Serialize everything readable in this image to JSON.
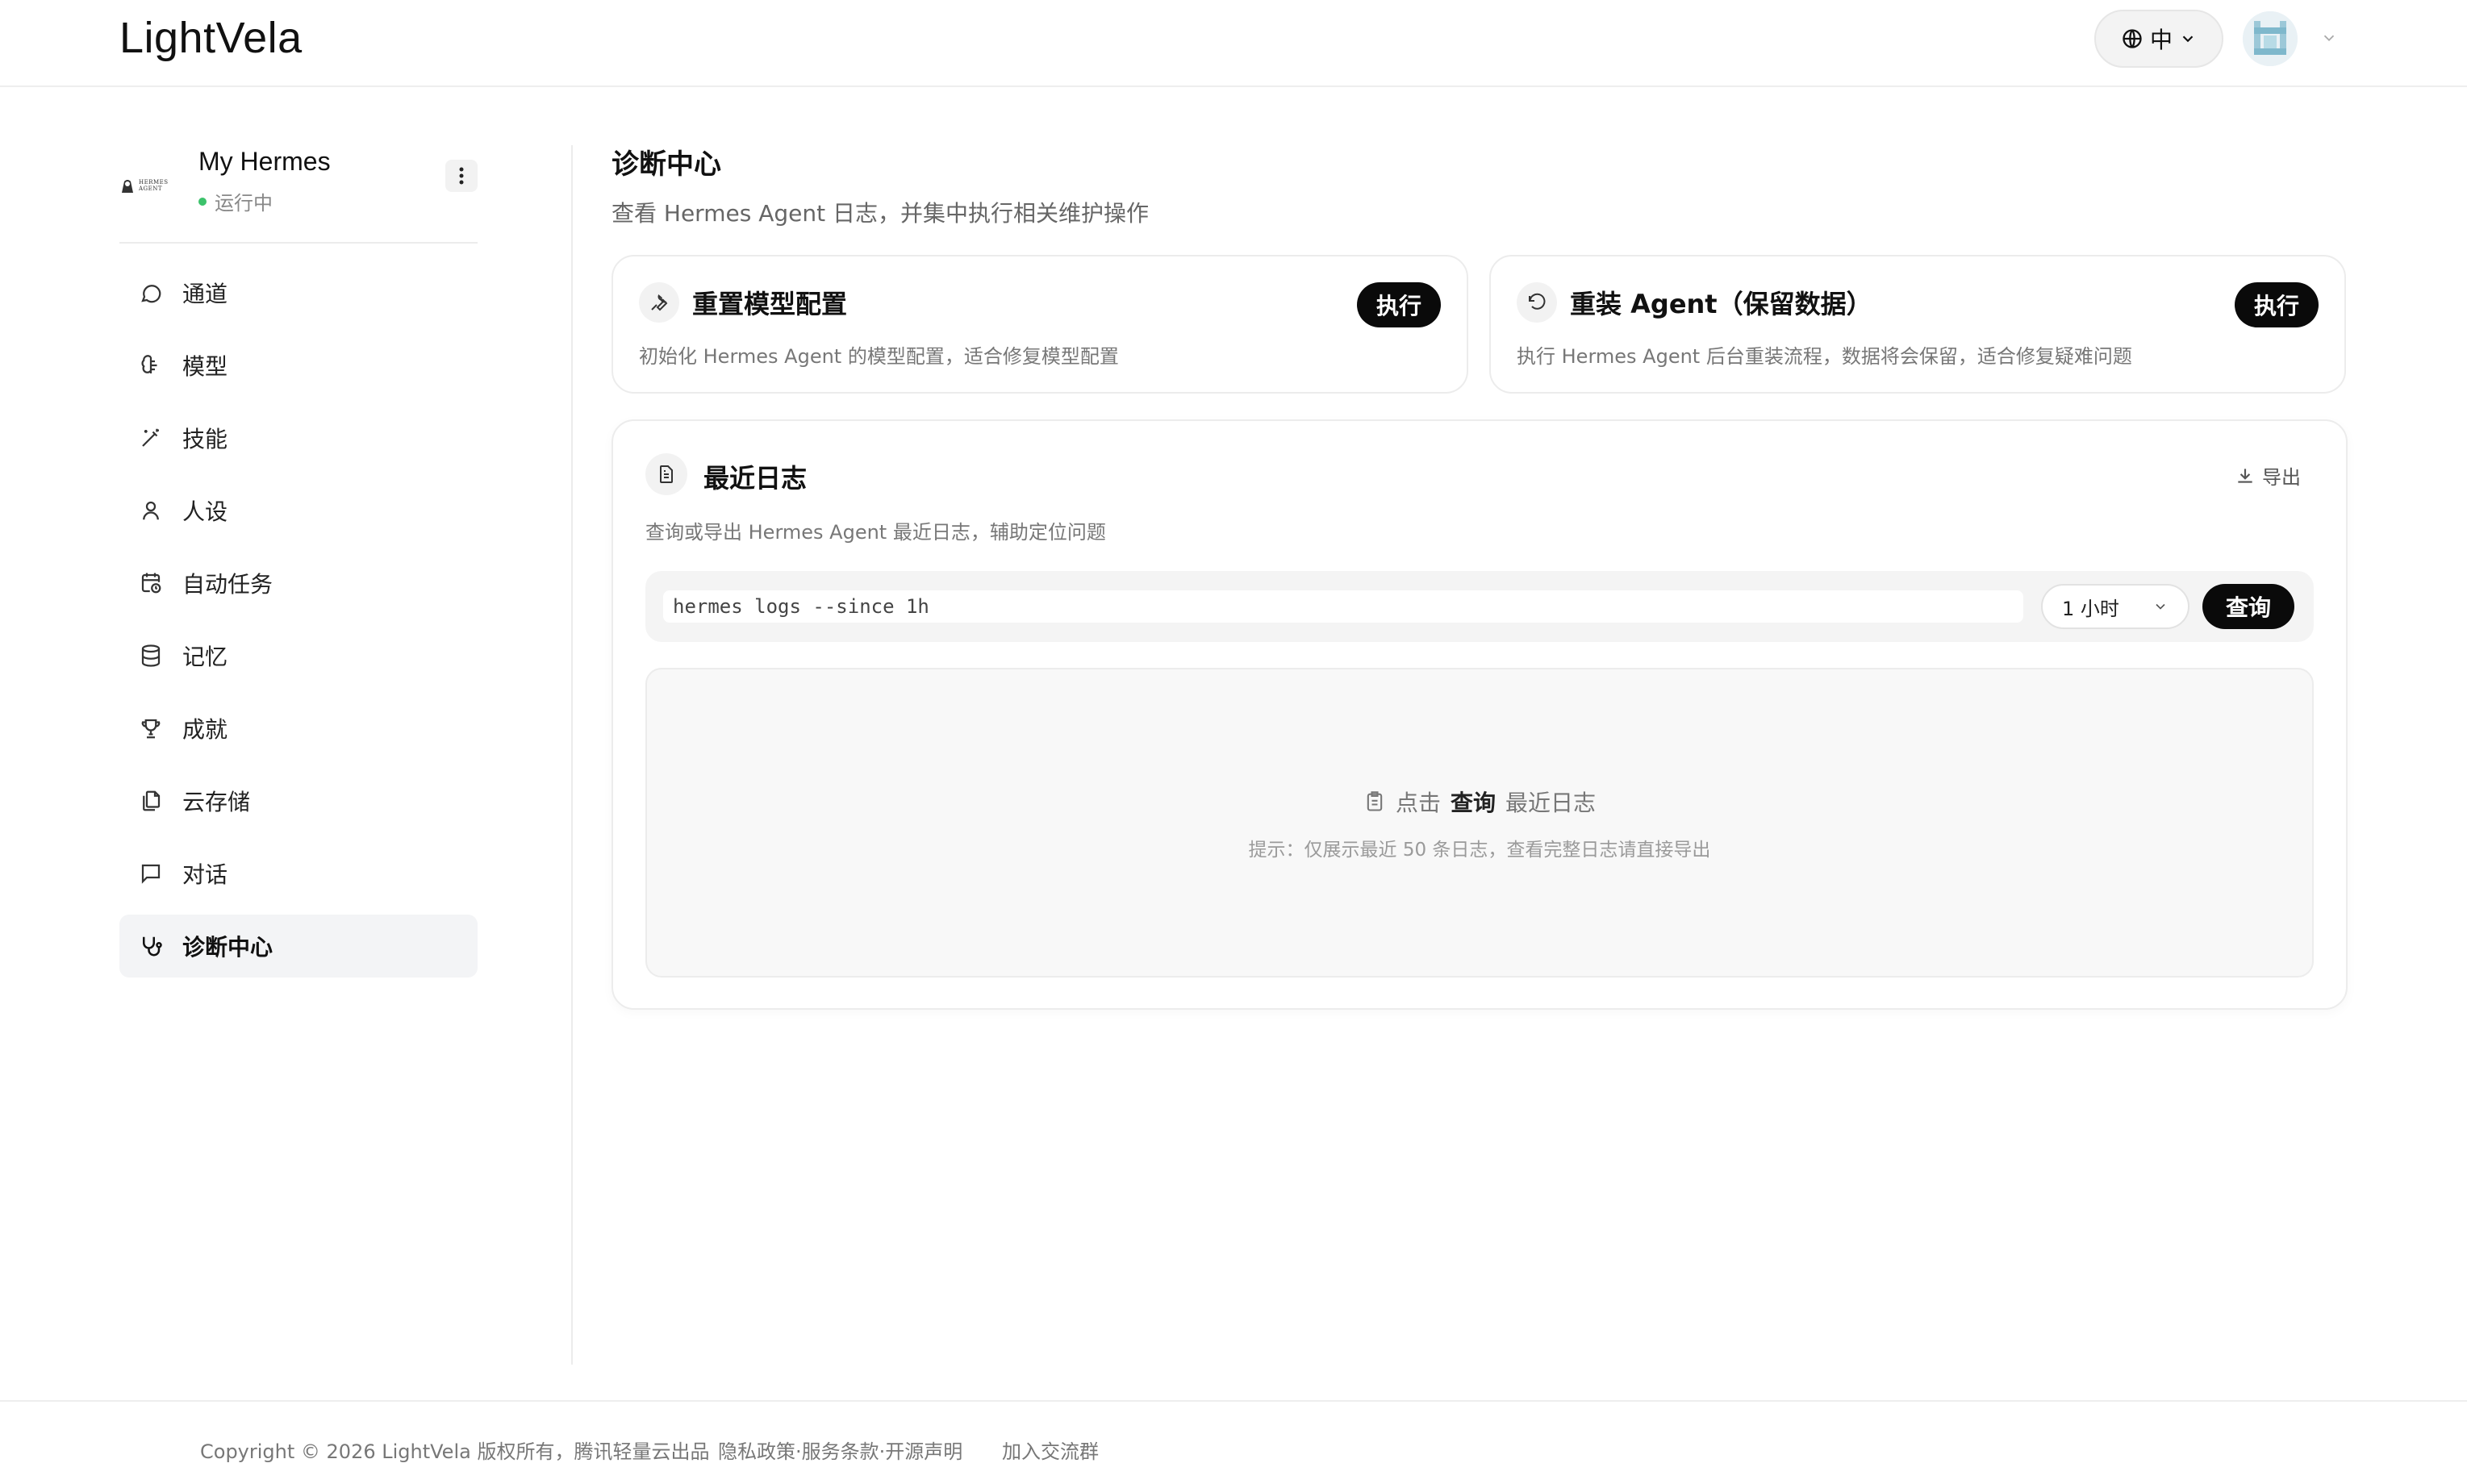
{
  "app": {
    "logo": "LightVela"
  },
  "header": {
    "lang_label": "中"
  },
  "agent": {
    "name": "My Hermes",
    "status": "运行中",
    "logo_text": "HERMES AGENT"
  },
  "sidebar": {
    "items": [
      {
        "label": "通道",
        "icon": "chat-bubble-icon"
      },
      {
        "label": "模型",
        "icon": "brain-icon"
      },
      {
        "label": "技能",
        "icon": "magic-wand-icon"
      },
      {
        "label": "人设",
        "icon": "user-icon"
      },
      {
        "label": "自动任务",
        "icon": "calendar-clock-icon"
      },
      {
        "label": "记忆",
        "icon": "database-icon"
      },
      {
        "label": "成就",
        "icon": "trophy-icon"
      },
      {
        "label": "云存储",
        "icon": "files-icon"
      },
      {
        "label": "对话",
        "icon": "message-square-icon"
      },
      {
        "label": "诊断中心",
        "icon": "stethoscope-icon",
        "active": true
      }
    ]
  },
  "main": {
    "title": "诊断中心",
    "subtitle": "查看 Hermes Agent 日志，并集中执行相关维护操作",
    "cards": [
      {
        "title": "重置模型配置",
        "desc": "初始化 Hermes Agent 的模型配置，适合修复模型配置",
        "button": "执行",
        "icon": "wrench-icon"
      },
      {
        "title": "重装 Agent（保留数据）",
        "desc": "执行 Hermes Agent 后台重装流程，数据将会保留，适合修复疑难问题",
        "button": "执行",
        "icon": "rotate-ccw-icon"
      }
    ],
    "logs": {
      "title": "最近日志",
      "export_label": "导出",
      "desc": "查询或导出 Hermes Agent 最近日志，辅助定位问题",
      "command": "hermes logs --since 1h",
      "time_range": "1 小时",
      "query_button": "查询",
      "empty": {
        "prefix": "点击",
        "action": "查询",
        "suffix": "最近日志",
        "hint": "提示：仅展示最近 50 条日志，查看完整日志请直接导出"
      }
    }
  },
  "footer": {
    "copyright": "Copyright © 2026 LightVela 版权所有，腾讯轻量云出品",
    "links": "隐私政策·服务条款·开源声明",
    "community": "加入交流群"
  },
  "colors": {
    "accent": "#0a0a0a",
    "status_running": "#3cc26b",
    "active_bg": "#f3f4f6"
  }
}
